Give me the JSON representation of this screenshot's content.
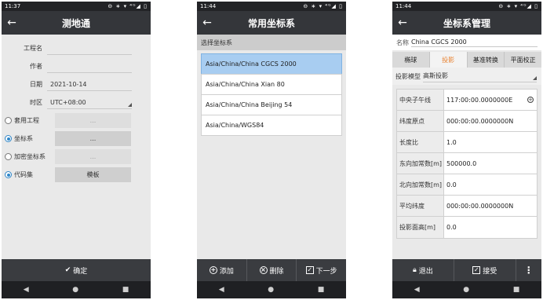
{
  "screen1": {
    "status_time": "11:37",
    "status_icons": "⊖ ∗ ▾ ⁴ᴳ◢ ▯",
    "title": "测地通",
    "fields": [
      {
        "label": "工程名",
        "value": ""
      },
      {
        "label": "作者",
        "value": ""
      },
      {
        "label": "日期",
        "value": "2021-10-14"
      },
      {
        "label": "时区",
        "value": "UTC+08:00"
      }
    ],
    "options": [
      {
        "label": "套用工程",
        "button": "...",
        "selected": false
      },
      {
        "label": "坐标系",
        "button": "...",
        "selected": true
      },
      {
        "label": "加密坐标系",
        "button": "...",
        "selected": false
      },
      {
        "label": "代码集",
        "button": "模板",
        "selected": true
      }
    ],
    "confirm_label": "确定"
  },
  "screen2": {
    "status_time": "11:44",
    "status_icons": "⊖ ∗ ▾ ⁴ᴳ◢ ▯",
    "title": "常用坐标系",
    "section": "选择坐标系",
    "items": [
      "Asia/China/China CGCS 2000",
      "Asia/China/China Xian 80",
      "Asia/China/China Beijing 54",
      "Asia/China/WGS84"
    ],
    "add_label": "添加",
    "delete_label": "删除",
    "next_label": "下一步"
  },
  "screen3": {
    "status_time": "11:44",
    "status_icons": "⊖ ∗ ▾ ⁴ᴳ◢ ▯",
    "title": "坐标系管理",
    "name_label": "名称",
    "name_value": "China CGCS 2000",
    "tabs": [
      "椭球",
      "投影",
      "基准转换",
      "平面校正"
    ],
    "active_tab": "投影",
    "proj_model_label": "投影模型",
    "proj_model_value": "高斯投影",
    "params": [
      {
        "key": "中央子午线",
        "value": "117:00:00.0000000E"
      },
      {
        "key": "纬度原点",
        "value": "000:00:00.0000000N"
      },
      {
        "key": "长度比",
        "value": "1.0"
      },
      {
        "key": "东向加常数[m]",
        "value": "500000.0"
      },
      {
        "key": "北向加常数[m]",
        "value": "0.0"
      },
      {
        "key": "平均纬度",
        "value": "000:00:00.0000000N"
      },
      {
        "key": "投影面高[m]",
        "value": "0.0"
      }
    ],
    "exit_label": "退出",
    "accept_label": "接受"
  },
  "nav": {
    "back": "◀",
    "home": "●",
    "recent": "■"
  }
}
